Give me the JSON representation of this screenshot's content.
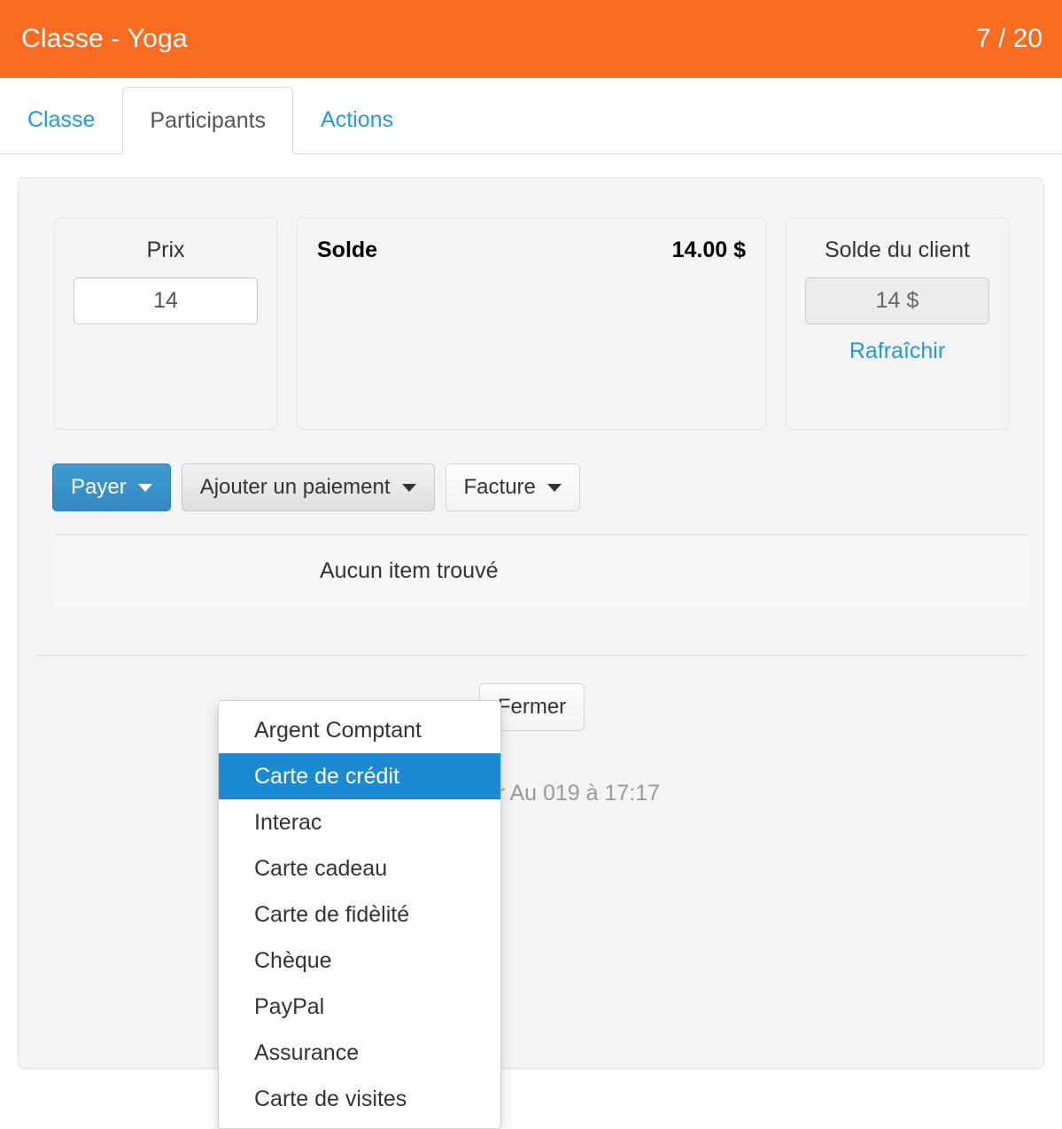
{
  "header": {
    "title": "Classe - Yoga",
    "count": "7 / 20"
  },
  "tabs": [
    {
      "label": "Classe",
      "active": false
    },
    {
      "label": "Participants",
      "active": true
    },
    {
      "label": "Actions",
      "active": false
    }
  ],
  "panels": {
    "prix": {
      "label": "Prix",
      "value": "14"
    },
    "solde": {
      "label": "Solde",
      "amount": "14.00 $"
    },
    "client": {
      "label": "Solde du client",
      "value": "14 $",
      "refresh_label": "Rafraîchir"
    }
  },
  "toolbar": {
    "pay_label": "Payer",
    "add_payment_label": "Ajouter un paiement",
    "invoice_label": "Facture"
  },
  "results": {
    "empty_text": "Aucun item trouvé"
  },
  "actions": {
    "close_label": "Fermer"
  },
  "footer": {
    "note": "Ajouté par Au                           019 à 17:17"
  },
  "payment_menu": {
    "items": [
      {
        "label": "Argent Comptant",
        "highlighted": false
      },
      {
        "label": "Carte de crédit",
        "highlighted": true
      },
      {
        "label": "Interac",
        "highlighted": false
      },
      {
        "label": "Carte cadeau",
        "highlighted": false
      },
      {
        "label": "Carte de fidèlité",
        "highlighted": false
      },
      {
        "label": "Chèque",
        "highlighted": false
      },
      {
        "label": "PayPal",
        "highlighted": false
      },
      {
        "label": "Assurance",
        "highlighted": false
      },
      {
        "label": "Carte de visites",
        "highlighted": false
      }
    ]
  },
  "colors": {
    "header_orange": "#f96b21",
    "link_blue": "#1f9ae0",
    "primary_blue": "#3b92c9",
    "menu_highlight": "#1b8ad1"
  }
}
